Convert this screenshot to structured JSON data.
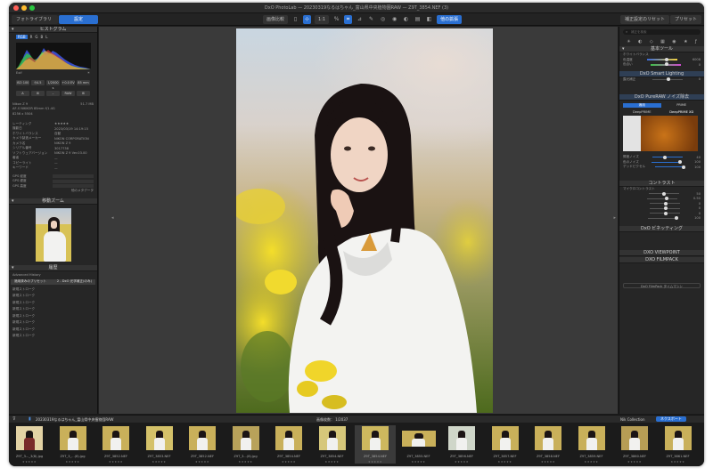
{
  "window": {
    "title": "DxO PhotoLab — 20230319なるはちゃん_富山県中央植物園RAW — Z9T_3854.NEF (3)"
  },
  "tabs": [
    {
      "label": "フォトライブラリ"
    },
    {
      "label": "設定"
    }
  ],
  "toolbar": {
    "compare_label": "画像比較",
    "zoom_label": "1:1",
    "pct_label": "%",
    "export_button": "他の拡張",
    "reset_label": "補正設定のリセット",
    "preset_label": "プリセット"
  },
  "left": {
    "histogram_title": "ヒストグラム",
    "channels": [
      "RGB",
      "R",
      "G",
      "B",
      "L"
    ],
    "exif_label": "Exif",
    "exif_row1": [
      "ISO 100",
      "f/4.5",
      "1/2000 s",
      "+0.0 EV",
      "85 mm"
    ],
    "exif_row2": [
      "A",
      "⊞",
      "–",
      "RAW",
      "⊞"
    ],
    "camera": "Nikon Z 9",
    "filesize": "51.7 MB",
    "lens": "AF-S NIKKOR 85mm f/1.4G",
    "dimensions": "8256 x 5504",
    "meta": [
      {
        "k": "レーティング",
        "v": "★★★★★"
      },
      {
        "k": "撮影日",
        "v": "2023/03/19 14:19:15"
      },
      {
        "k": "ホワイトバランス",
        "v": "自動"
      },
      {
        "k": "カメラ製造メーカー",
        "v": "NIKON CORPORATION"
      },
      {
        "k": "カメラ名",
        "v": "NIKON Z 9"
      },
      {
        "k": "シリアル番号",
        "v": "3017738"
      },
      {
        "k": "ソフトウェアバージョン",
        "v": "NIKON Z 9 Ver.03.00"
      },
      {
        "k": "著者",
        "v": "—"
      },
      {
        "k": "コピーライト",
        "v": "—"
      },
      {
        "k": "キーワード",
        "v": "—"
      }
    ],
    "gps": [
      "GPS 経度",
      "GPS 緯度",
      "GPS 高度"
    ],
    "more_label": "他のメタデータ",
    "loupe_title": "移動ズーム",
    "history_title": "履歴",
    "advanced_history": "Advanced History",
    "history_selected": "適用済みのプリセット",
    "history_selected_value": "2 - DxO 光学補正(のみ)",
    "history_item": "新規ストローク"
  },
  "right": {
    "search_placeholder": "補正を検索",
    "basic_tools": "基本ツール",
    "white_balance": "ホワイトバランス",
    "temp_label": "色温度",
    "temp_value": "6008",
    "tint_label": "色合い",
    "tint_value": "0",
    "smart_lighting": "DxO Smart Lighting",
    "exposure_label": "露光補正",
    "denoise_title": "DxO PureRAW ノイズ除去",
    "prime_label": "PRIME",
    "deepprime_label": "DeepPRIME",
    "deepprimexd_label": "DeepPRIME XD",
    "apply_label": "適用",
    "luminance_label": "輝度ノイズ",
    "luminance_value": "40",
    "chroma_label": "色のノイズ",
    "chroma_value": "100",
    "dead_label": "デッドピクセル",
    "dead_value": "100",
    "contrast_title": "コントラスト",
    "microcontrast": "マイクロコントラスト",
    "vignetting_title": "DxO ビネッティング",
    "viewpoint_title": "DXO VIEWPOINT",
    "filmpack_title": "DXO FILMPACK",
    "collection_label": "DxO FilmPack タイムマシン",
    "preview_value": "100%",
    "values": [
      "50",
      "0.50",
      "0",
      "0",
      "0",
      "100"
    ]
  },
  "filmbar": {
    "path": "20230319なるはちゃん_富山県中央植物園RAW",
    "count": "画像枚数：  1/2037",
    "nik_label": "Nik Collection",
    "export_label": "ネクスポート"
  },
  "thumbs": [
    {
      "name": "Z9T_3..._3(8).jpg"
    },
    {
      "name": "Z9T_3_...(8).jpg"
    },
    {
      "name": "Z9T_3852.NEF"
    },
    {
      "name": "Z9T_3853.NEF"
    },
    {
      "name": "Z9T_3852.NEF"
    },
    {
      "name": "Z9T_3...(8).jpg"
    },
    {
      "name": "Z9T_3854.NEF"
    },
    {
      "name": "Z9T_3854.NEF"
    },
    {
      "name": "Z9T_3854.NEF"
    },
    {
      "name": "Z9T_3855.NEF"
    },
    {
      "name": "Z9T_3856.NEF"
    },
    {
      "name": "Z9T_3857.NEF"
    },
    {
      "name": "Z9T_3858.NEF"
    },
    {
      "name": "Z9T_3859.NEF"
    },
    {
      "name": "Z9T_3860.NEF"
    },
    {
      "name": "Z9T_3861.NEF"
    },
    {
      "name": "Z9T_3862.NEF"
    }
  ]
}
